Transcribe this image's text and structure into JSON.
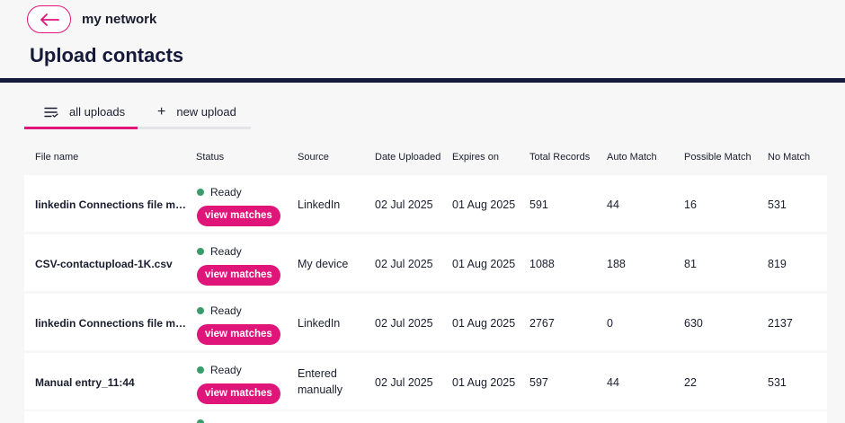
{
  "header": {
    "back_label": "back",
    "breadcrumb": "my network",
    "title": "Upload contacts"
  },
  "tabs": [
    {
      "label": "all uploads",
      "active": true,
      "icon": "list-icon"
    },
    {
      "label": "new upload",
      "active": false,
      "icon": "plus-icon"
    }
  ],
  "table": {
    "columns": [
      "File name",
      "Status",
      "Source",
      "Date Uploaded",
      "Expires on",
      "Total Records",
      "Auto Match",
      "Possible Match",
      "No Match"
    ],
    "rows": [
      {
        "file": "linkedin Connections file marc...",
        "status": "Ready",
        "action": "view matches",
        "source": "LinkedIn",
        "uploaded": "02 Jul 2025",
        "expires": "01 Aug 2025",
        "total": "591",
        "auto": "44",
        "possible": "16",
        "none": "531"
      },
      {
        "file": "CSV-contactupload-1K.csv",
        "status": "Ready",
        "action": "view matches",
        "source": "My device",
        "uploaded": "02 Jul 2025",
        "expires": "01 Aug 2025",
        "total": "1088",
        "auto": "188",
        "possible": "81",
        "none": "819"
      },
      {
        "file": "linkedin Connections file marc...",
        "status": "Ready",
        "action": "view matches",
        "source": "LinkedIn",
        "uploaded": "02 Jul 2025",
        "expires": "01 Aug 2025",
        "total": "2767",
        "auto": "0",
        "possible": "630",
        "none": "2137"
      },
      {
        "file": "Manual entry_11:44",
        "status": "Ready",
        "action": "view matches",
        "source_line1": "Entered",
        "source_line2": "manually",
        "uploaded": "02 Jul 2025",
        "expires": "01 Aug 2025",
        "total": "597",
        "auto": "44",
        "possible": "22",
        "none": "531"
      }
    ]
  },
  "colors": {
    "accent": "#e0157a",
    "navy": "#141a3c",
    "ready_dot": "#3b9c6b"
  }
}
